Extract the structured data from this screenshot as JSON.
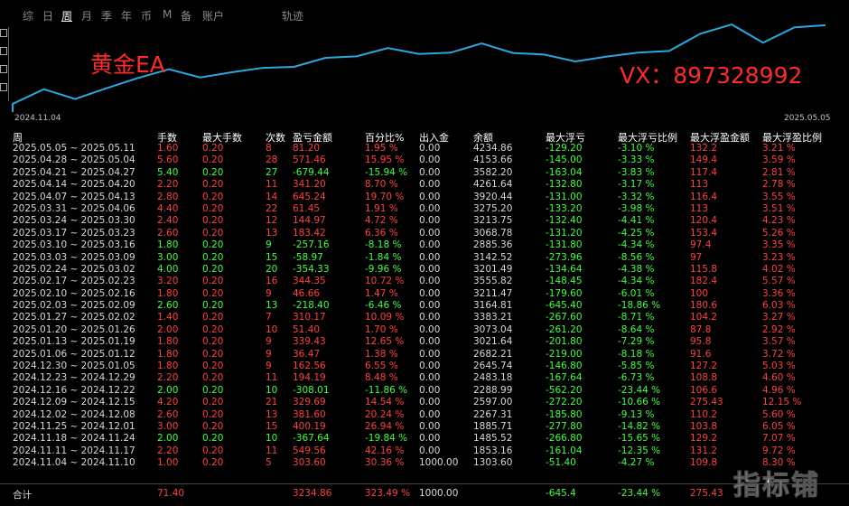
{
  "tabs": [
    {
      "label": "综"
    },
    {
      "label": "日"
    },
    {
      "label": "周",
      "active": true
    },
    {
      "label": "月"
    },
    {
      "label": "季"
    },
    {
      "label": "年"
    },
    {
      "label": "币"
    },
    {
      "label": "M"
    },
    {
      "label": "备"
    },
    {
      "label": "账户"
    },
    {
      "label": "轨迹"
    }
  ],
  "chart": {
    "overlay_left": "黄金EA",
    "overlay_right": "VX：897328992",
    "date_start": "2024.11.04",
    "date_end": "2025.05.05",
    "line_color": "#29a8e0",
    "balance": [
      1303.6,
      1853.16,
      1485.52,
      1885.71,
      2267.31,
      2597.0,
      2288.99,
      2483.18,
      2645.74,
      2682.21,
      3021.64,
      3073.04,
      3383.21,
      3164.81,
      3211.47,
      3555.82,
      3201.49,
      3142.52,
      2885.36,
      3068.78,
      3213.75,
      3275.2,
      3920.44,
      4261.64,
      3582.2,
      4153.66,
      4234.86
    ]
  },
  "table": {
    "headers": [
      "周",
      "手数",
      "最大手数",
      "次数",
      "盈亏金额",
      "百分比%",
      "出入金",
      "余额",
      "最大浮亏",
      "最大浮亏比例",
      "最大浮盈金额",
      "最大浮盈比例"
    ],
    "rows": [
      [
        "2025.05.05 ~ 2025.05.11",
        "1.60",
        "0.20",
        "8",
        "81.20",
        "1.95 %",
        "0.00",
        "4234.86",
        "-129.20",
        "-3.10 %",
        "132.2",
        "3.21 %",
        "r"
      ],
      [
        "2025.04.28 ~ 2025.05.04",
        "5.60",
        "0.20",
        "28",
        "571.46",
        "15.95 %",
        "0.00",
        "4153.66",
        "-145.00",
        "-3.33 %",
        "149.4",
        "3.59 %",
        "r"
      ],
      [
        "2025.04.21 ~ 2025.04.27",
        "5.40",
        "0.20",
        "27",
        "-679.44",
        "-15.94 %",
        "0.00",
        "3582.20",
        "-163.04",
        "-3.83 %",
        "117.4",
        "2.81 %",
        "g"
      ],
      [
        "2025.04.14 ~ 2025.04.20",
        "2.20",
        "0.20",
        "11",
        "341.20",
        "8.70 %",
        "0.00",
        "4261.64",
        "-132.80",
        "-3.17 %",
        "113",
        "2.78 %",
        "r"
      ],
      [
        "2025.04.07 ~ 2025.04.13",
        "2.80",
        "0.20",
        "14",
        "645.24",
        "19.70 %",
        "0.00",
        "3920.44",
        "-131.00",
        "-3.32 %",
        "116.4",
        "3.55 %",
        "r"
      ],
      [
        "2025.03.31 ~ 2025.04.06",
        "4.40",
        "0.20",
        "22",
        "61.45",
        "1.91 %",
        "0.00",
        "3275.20",
        "-133.20",
        "-3.98 %",
        "113",
        "3.51 %",
        "r"
      ],
      [
        "2025.03.24 ~ 2025.03.30",
        "2.40",
        "0.20",
        "12",
        "144.97",
        "4.72 %",
        "0.00",
        "3213.75",
        "-132.40",
        "-4.41 %",
        "120.4",
        "4.23 %",
        "r"
      ],
      [
        "2025.03.17 ~ 2025.03.23",
        "2.60",
        "0.20",
        "13",
        "183.42",
        "6.36 %",
        "0.00",
        "3068.78",
        "-131.20",
        "-4.25 %",
        "153.4",
        "5.26 %",
        "r"
      ],
      [
        "2025.03.10 ~ 2025.03.16",
        "1.80",
        "0.20",
        "9",
        "-257.16",
        "-8.18 %",
        "0.00",
        "2885.36",
        "-131.80",
        "-4.34 %",
        "97.4",
        "3.35 %",
        "g"
      ],
      [
        "2025.03.03 ~ 2025.03.09",
        "3.00",
        "0.20",
        "15",
        "-58.97",
        "-1.84 %",
        "0.00",
        "3142.52",
        "-273.96",
        "-8.56 %",
        "97",
        "3.23 %",
        "g"
      ],
      [
        "2025.02.24 ~ 2025.03.02",
        "4.00",
        "0.20",
        "20",
        "-354.33",
        "-9.96 %",
        "0.00",
        "3201.49",
        "-134.64",
        "-4.38 %",
        "115.8",
        "4.02 %",
        "g"
      ],
      [
        "2025.02.17 ~ 2025.02.23",
        "3.20",
        "0.20",
        "16",
        "344.35",
        "10.72 %",
        "0.00",
        "3555.82",
        "-148.45",
        "-4.34 %",
        "182.4",
        "5.57 %",
        "r"
      ],
      [
        "2025.02.10 ~ 2025.02.16",
        "1.80",
        "0.20",
        "9",
        "46.66",
        "1.47 %",
        "0.00",
        "3211.47",
        "-179.60",
        "-6.01 %",
        "100",
        "3.36 %",
        "r"
      ],
      [
        "2025.02.03 ~ 2025.02.09",
        "2.60",
        "0.20",
        "13",
        "-218.40",
        "-6.46 %",
        "0.00",
        "3164.81",
        "-645.40",
        "-18.86 %",
        "180.6",
        "6.03 %",
        "g"
      ],
      [
        "2025.01.27 ~ 2025.02.02",
        "1.40",
        "0.20",
        "7",
        "310.17",
        "10.09 %",
        "0.00",
        "3383.21",
        "-267.60",
        "-8.71 %",
        "104.2",
        "3.27 %",
        "r"
      ],
      [
        "2025.01.20 ~ 2025.01.26",
        "2.00",
        "0.20",
        "10",
        "51.40",
        "1.70 %",
        "0.00",
        "3073.04",
        "-261.20",
        "-8.64 %",
        "87.8",
        "2.92 %",
        "r"
      ],
      [
        "2025.01.13 ~ 2025.01.19",
        "1.80",
        "0.20",
        "9",
        "339.43",
        "12.65 %",
        "0.00",
        "3021.64",
        "-201.80",
        "-7.29 %",
        "95.8",
        "3.57 %",
        "r"
      ],
      [
        "2025.01.06 ~ 2025.01.12",
        "1.80",
        "0.20",
        "9",
        "36.47",
        "1.38 %",
        "0.00",
        "2682.21",
        "-219.00",
        "-8.18 %",
        "91.6",
        "3.72 %",
        "r"
      ],
      [
        "2024.12.30 ~ 2025.01.05",
        "1.80",
        "0.20",
        "9",
        "162.56",
        "6.55 %",
        "0.00",
        "2645.74",
        "-146.80",
        "-5.85 %",
        "127.2",
        "5.03 %",
        "r"
      ],
      [
        "2024.12.23 ~ 2024.12.29",
        "2.20",
        "0.20",
        "11",
        "194.19",
        "8.48 %",
        "0.00",
        "2483.18",
        "-167.64",
        "-6.73 %",
        "108.8",
        "4.60 %",
        "r"
      ],
      [
        "2024.12.16 ~ 2024.12.22",
        "2.00",
        "0.20",
        "10",
        "-308.01",
        "-11.86 %",
        "0.00",
        "2288.99",
        "-562.20",
        "-23.44 %",
        "106.6",
        "4.96 %",
        "g"
      ],
      [
        "2024.12.09 ~ 2024.12.15",
        "4.20",
        "0.20",
        "21",
        "329.69",
        "14.54 %",
        "0.00",
        "2597.00",
        "-272.20",
        "-10.66 %",
        "275.43",
        "12.15 %",
        "r"
      ],
      [
        "2024.12.02 ~ 2024.12.08",
        "2.60",
        "0.20",
        "13",
        "381.60",
        "20.24 %",
        "0.00",
        "2267.31",
        "-185.80",
        "-9.13 %",
        "110.2",
        "5.60 %",
        "r"
      ],
      [
        "2024.11.25 ~ 2024.12.01",
        "3.00",
        "0.20",
        "15",
        "400.19",
        "26.94 %",
        "0.00",
        "1885.71",
        "-277.80",
        "-14.82 %",
        "103.8",
        "6.05 %",
        "r"
      ],
      [
        "2024.11.18 ~ 2024.11.24",
        "2.00",
        "0.20",
        "10",
        "-367.64",
        "-19.84 %",
        "0.00",
        "1485.52",
        "-266.80",
        "-15.65 %",
        "129.2",
        "7.07 %",
        "g"
      ],
      [
        "2024.11.11 ~ 2024.11.17",
        "2.20",
        "0.20",
        "11",
        "549.56",
        "42.16 %",
        "0.00",
        "1853.16",
        "-161.04",
        "-12.35 %",
        "131.2",
        "9.72 %",
        "r"
      ],
      [
        "2024.11.04 ~ 2024.11.10",
        "1.00",
        "0.20",
        "5",
        "303.60",
        "30.36 %",
        "1000.00",
        "1303.60",
        "-51.40",
        "-4.27 %",
        "109.8",
        "8.30 %",
        "r"
      ]
    ]
  },
  "footer": {
    "label": "合计",
    "lots": "71.40",
    "profit": "3234.86",
    "percent": "323.49 %",
    "deposit": "1000.00",
    "max_dd": "-645.4",
    "max_dd_pct": "-23.44 %",
    "max_float": "275.43"
  },
  "watermark": "指标铺"
}
